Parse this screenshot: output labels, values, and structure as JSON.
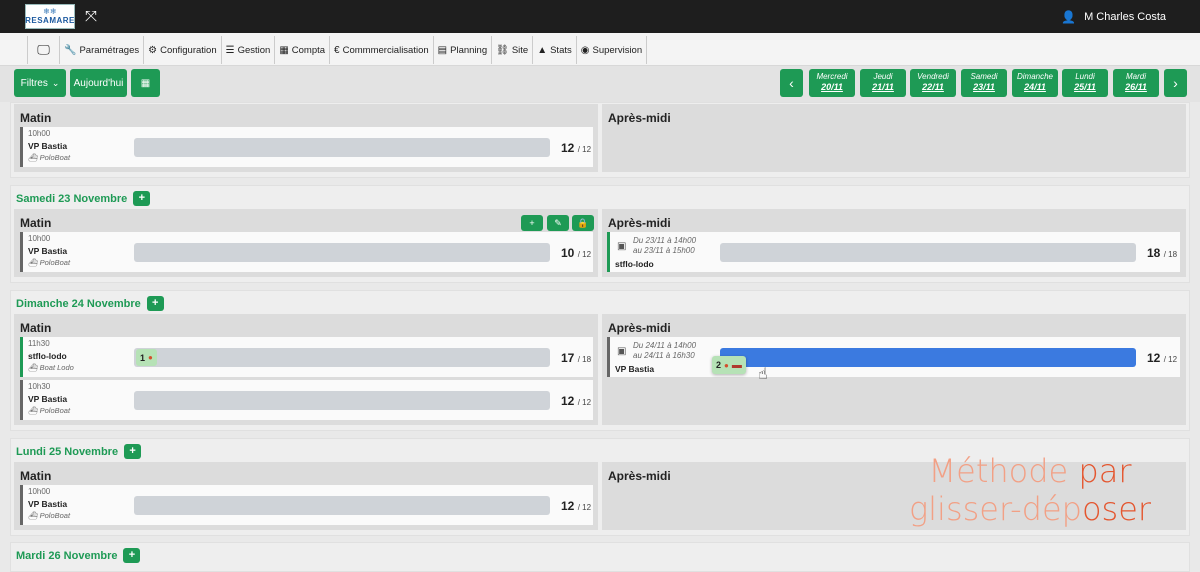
{
  "header": {
    "logo_text": "RESAMARE",
    "user_name": "M Charles Costa"
  },
  "nav": {
    "items": [
      {
        "label": "",
        "icon": "monitor-icon"
      },
      {
        "label": "Paramétrages",
        "icon": "wrench-icon"
      },
      {
        "label": "Configuration",
        "icon": "cogs-icon"
      },
      {
        "label": "Gestion",
        "icon": "list-icon"
      },
      {
        "label": "Compta",
        "icon": "calculator-icon"
      },
      {
        "label": "Commmercialisation",
        "icon": "euro-icon"
      },
      {
        "label": "Planning",
        "icon": "calendar-icon"
      },
      {
        "label": "Site",
        "icon": "sitemap-icon"
      },
      {
        "label": "Stats",
        "icon": "chart-icon"
      },
      {
        "label": "Supervision",
        "icon": "eye-icon"
      }
    ]
  },
  "toolbar": {
    "filters_label": "Filtres",
    "today_label": "Aujourd'hui",
    "days": [
      {
        "day": "Mercredi",
        "date": "20/11"
      },
      {
        "day": "Jeudi",
        "date": "21/11"
      },
      {
        "day": "Vendredi",
        "date": "22/11"
      },
      {
        "day": "Samedi",
        "date": "23/11"
      },
      {
        "day": "Dimanche",
        "date": "24/11"
      },
      {
        "day": "Lundi",
        "date": "25/11"
      },
      {
        "day": "Mardi",
        "date": "26/11"
      }
    ]
  },
  "labels": {
    "morning": "Matin",
    "afternoon": "Après-midi"
  },
  "sections": {
    "s0": {
      "morning_slot": {
        "time": "10h00",
        "name": "VP Bastia",
        "boat": "PoloBoat",
        "cap": "12",
        "total": "12"
      }
    },
    "s1": {
      "title": "Samedi 23 Novembre",
      "morning_slot": {
        "time": "10h00",
        "name": "VP Bastia",
        "boat": "PoloBoat",
        "cap": "10",
        "total": "12"
      },
      "afternoon_slot": {
        "dates1": "Du 23/11 à 14h00",
        "dates2": "au 23/11 à 15h00",
        "name": "stflo-lodo",
        "cap": "18",
        "total": "18"
      }
    },
    "s2": {
      "title": "Dimanche 24 Novembre",
      "morning_slot1": {
        "time": "11h30",
        "name": "stflo-lodo",
        "boat": "Boat Lodo",
        "badge": "1",
        "cap": "17",
        "total": "18"
      },
      "morning_slot2": {
        "time": "10h30",
        "name": "VP Bastia",
        "boat": "PoloBoat",
        "cap": "12",
        "total": "12"
      },
      "afternoon_slot": {
        "dates1": "Du 24/11 à 14h00",
        "dates2": "au 24/11 à 16h30",
        "name": "VP Bastia",
        "badge": "2",
        "cap": "12",
        "total": "12"
      }
    },
    "s3": {
      "title": "Lundi 25 Novembre",
      "morning_slot": {
        "time": "10h00",
        "name": "VP Bastia",
        "boat": "PoloBoat",
        "cap": "12",
        "total": "12"
      }
    },
    "s4": {
      "title": "Mardi 26 Novembre"
    }
  },
  "overlay": {
    "line1a": "Méthode",
    "line1b": "par",
    "line2a": "glisser-dép",
    "line2b": "oser"
  }
}
